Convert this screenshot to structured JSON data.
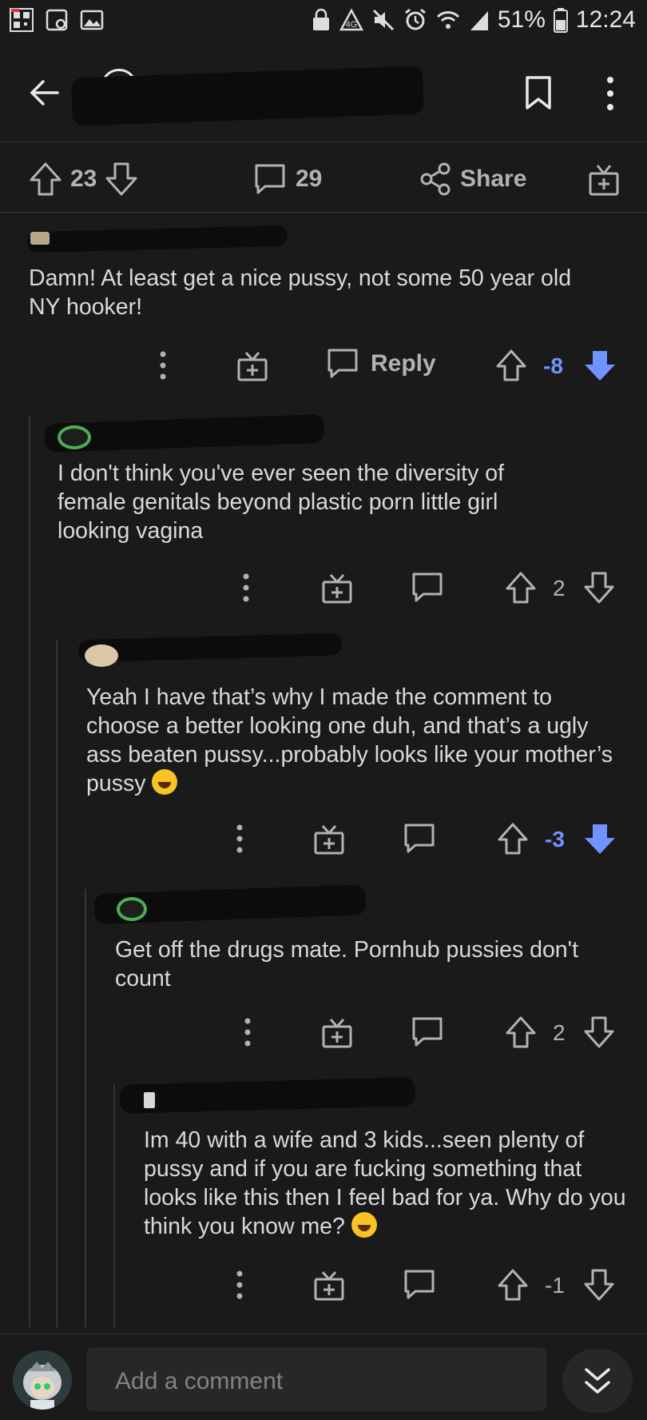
{
  "status_bar": {
    "battery": "51%",
    "time": "12:24"
  },
  "post_bar": {
    "upvotes": "23",
    "comments": "29",
    "share_label": "Share"
  },
  "comments": [
    {
      "body": "Damn!  At least get a nice pussy, not some 50 year old NY hooker!",
      "reply_label": "Reply",
      "score": "-8"
    },
    {
      "body": "I don't think you've ever seen the diversity of female genitals beyond plastic porn little girl looking vagina",
      "score": "2"
    },
    {
      "body": "Yeah I have that’s why I made the comment to choose a better looking one duh, and that’s a ugly ass beaten pussy...probably looks like your mother’s pussy",
      "score": "-3"
    },
    {
      "body": "Get off the drugs mate. Pornhub pussies don't count",
      "score": "2"
    },
    {
      "body": "Im 40 with a wife and 3 kids...seen plenty of pussy and if you are fucking something that looks like this then I feel bad for ya.  Why do you think you know me?",
      "score": "-1"
    }
  ],
  "bottom_bar": {
    "comment_placeholder": "Add a comment"
  },
  "colors": {
    "background": "#1a1a1b",
    "downvote_active": "#7193ff",
    "text": "#d7dadc",
    "muted": "#b0b3b5"
  }
}
